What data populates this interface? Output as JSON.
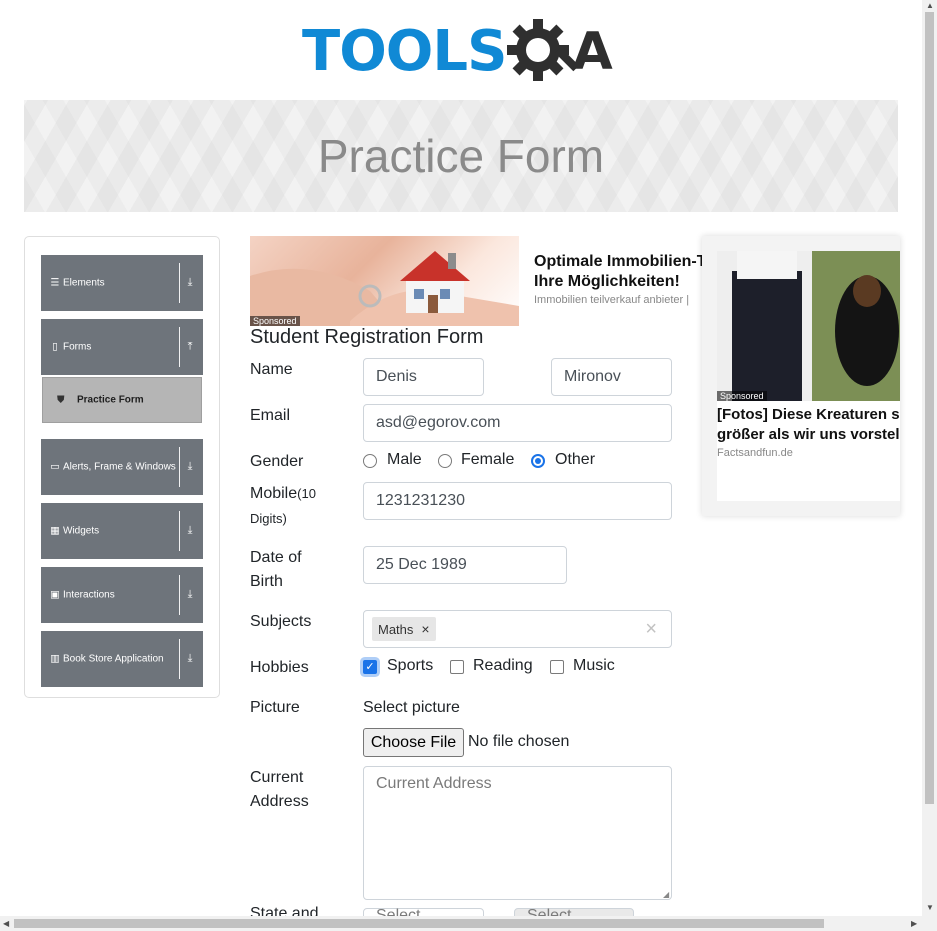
{
  "header": {
    "logo_text_tools": "TOOLS",
    "logo_text_a": "A"
  },
  "banner": {
    "title": "Practice Form"
  },
  "sidebar": {
    "groups": [
      {
        "label": "Elements",
        "icon": "list-icon",
        "arrow": "download-arrow"
      },
      {
        "label": "Forms",
        "icon": "document-icon",
        "arrow": "upload-arrow"
      },
      {
        "label": "Alerts, Frame & Windows",
        "icon": "window-icon",
        "arrow": "download-arrow"
      },
      {
        "label": "Widgets",
        "icon": "grid-icon",
        "arrow": "download-arrow"
      },
      {
        "label": "Interactions",
        "icon": "box-icon",
        "arrow": "download-arrow"
      },
      {
        "label": "Book Store Application",
        "icon": "books-icon",
        "arrow": "download-arrow"
      }
    ],
    "active_item": {
      "label": "Practice Form",
      "icon": "html5-icon"
    }
  },
  "ads": {
    "ad1": {
      "badge": "Sponsored",
      "title_line1": "Optimale Immobilien-T",
      "title_line2": "Ihre Möglichkeiten!",
      "source": "Immobilien teilverkauf anbieter |"
    },
    "ad2": {
      "badge": "Sponsored",
      "title_line1": "[Fotos] Diese Kreaturen sir",
      "title_line2": "größer als wir uns vorstelle",
      "source": "Factsandfun.de"
    }
  },
  "form": {
    "title": "Student Registration Form",
    "name_label": "Name",
    "first_name": "Denis",
    "last_name": "Mironov",
    "email_label": "Email",
    "email": "asd@egorov.com",
    "gender_label": "Gender",
    "gender_options": [
      "Male",
      "Female",
      "Other"
    ],
    "gender_selected": "Other",
    "mobile_label": "Mobile",
    "mobile_hint_a": "(10",
    "mobile_hint_b": "Digits)",
    "mobile": "1231231230",
    "dob_label_line1": "Date of",
    "dob_label_line2": "Birth",
    "dob": "25 Dec 1989",
    "subjects_label": "Subjects",
    "subjects": [
      "Maths"
    ],
    "subjects_clear": "×",
    "hobbies_label": "Hobbies",
    "hobbies": [
      {
        "label": "Sports",
        "checked": true
      },
      {
        "label": "Reading",
        "checked": false
      },
      {
        "label": "Music",
        "checked": false
      }
    ],
    "picture_label": "Picture",
    "picture_prompt": "Select picture",
    "choose_file": "Choose File",
    "no_file": "No file chosen",
    "address_label_line1": "Current",
    "address_label_line2": "Address",
    "address_placeholder": "Current Address",
    "state_label_partial": "State and",
    "state_placeholder": "Select",
    "city_placeholder": "Select"
  },
  "colors": {
    "logo_blue": "#1089d5",
    "sidebar_group": "#6e747b",
    "active_item": "#b5b5b5",
    "accent": "#1a73e8"
  }
}
